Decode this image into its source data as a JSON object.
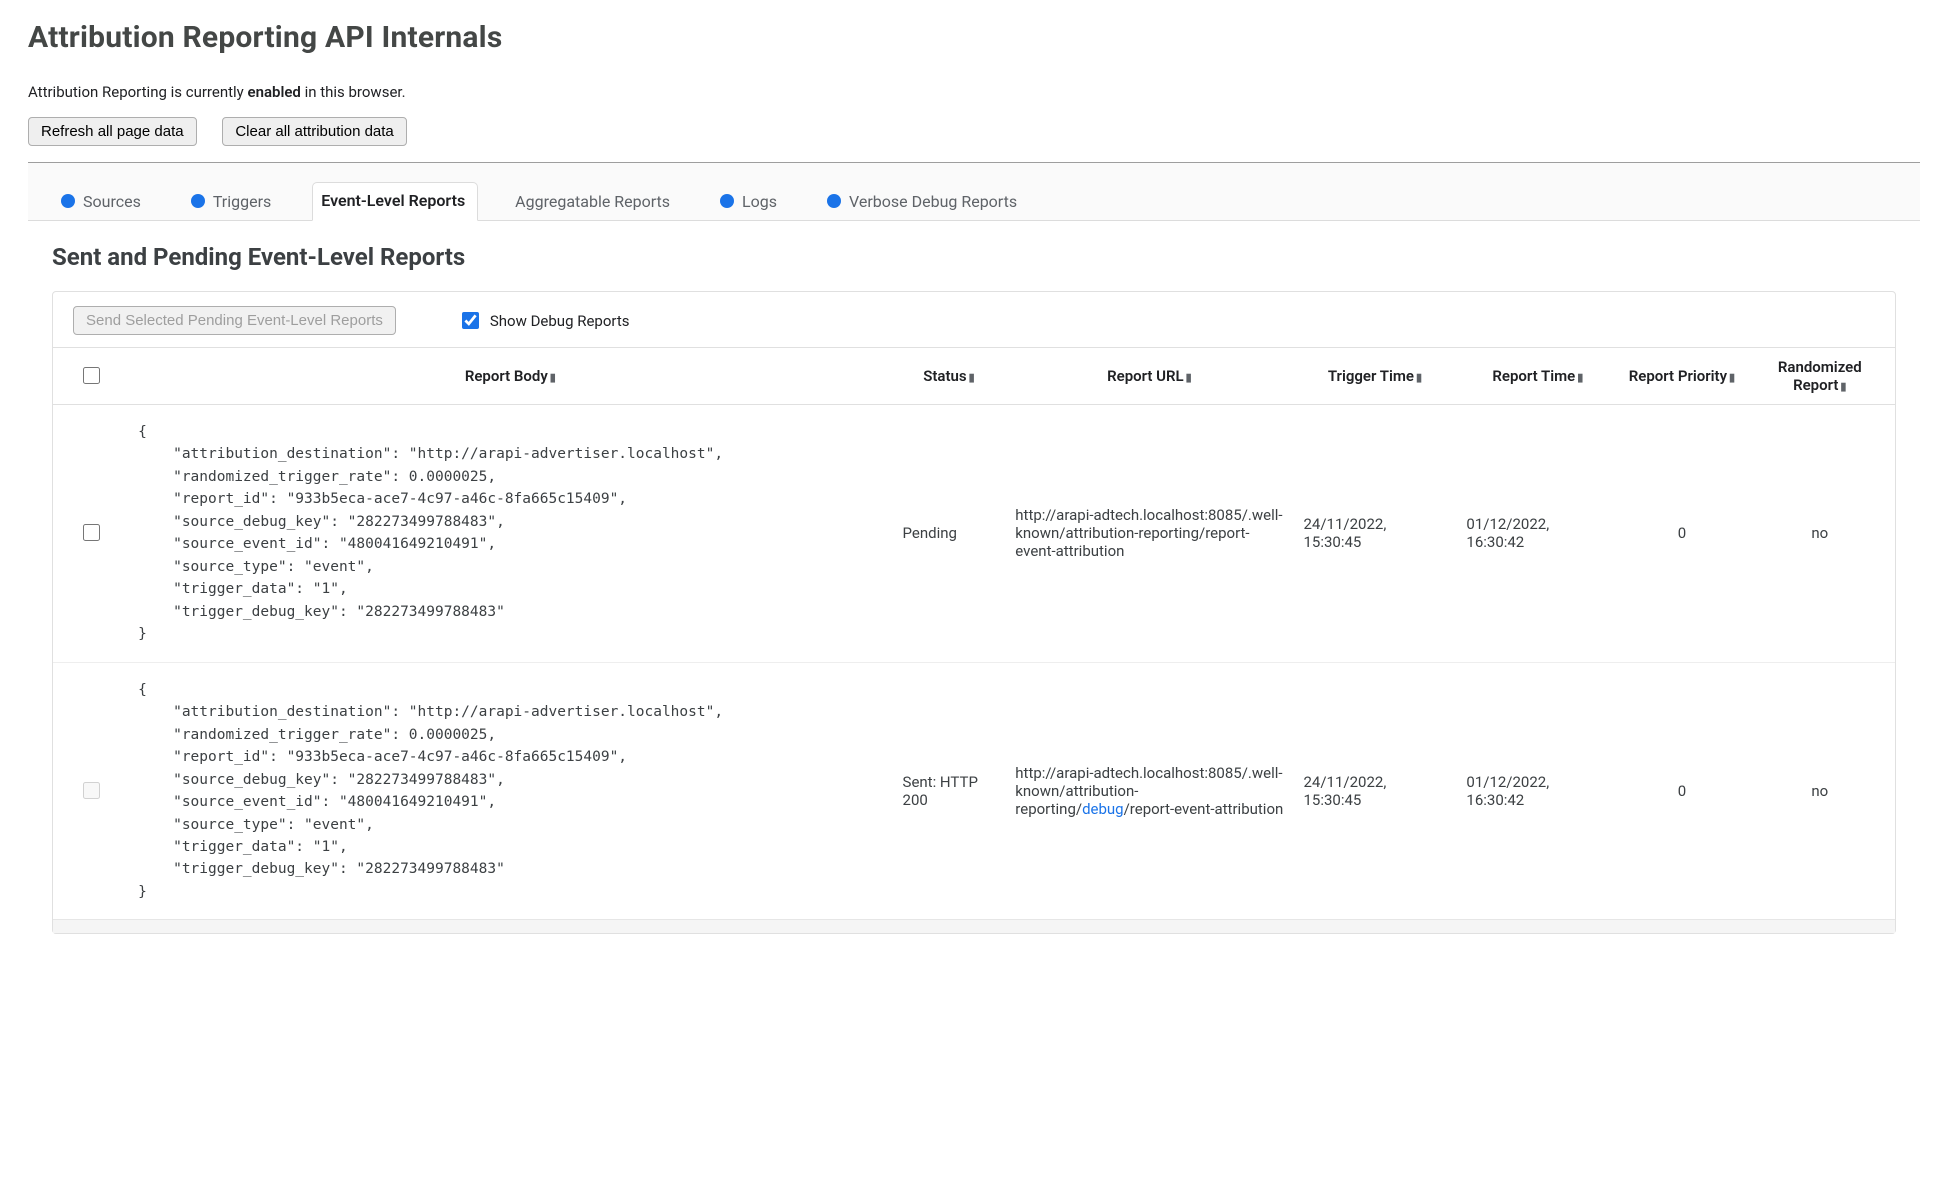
{
  "header": {
    "title": "Attribution Reporting API Internals",
    "status_prefix": "Attribution Reporting is currently ",
    "status_word": "enabled",
    "status_suffix": " in this browser.",
    "refresh_btn": "Refresh all page data",
    "clear_btn": "Clear all attribution data"
  },
  "tabs": [
    {
      "label": "Sources",
      "dot": true
    },
    {
      "label": "Triggers",
      "dot": true
    },
    {
      "label": "Event-Level Reports",
      "dot": false,
      "active": true
    },
    {
      "label": "Aggregatable Reports",
      "dot": false
    },
    {
      "label": "Logs",
      "dot": true
    },
    {
      "label": "Verbose Debug Reports",
      "dot": true
    }
  ],
  "section": {
    "heading": "Sent and Pending Event-Level Reports",
    "send_btn": "Send Selected Pending Event-Level Reports",
    "show_debug_label": "Show Debug Reports",
    "show_debug_checked": true
  },
  "columns": {
    "body": "Report Body",
    "status": "Status",
    "url": "Report URL",
    "tt": "Trigger Time",
    "rt": "Report Time",
    "pri": "Report Priority",
    "rand": "Randomized Report"
  },
  "rows": [
    {
      "body": "{\n    \"attribution_destination\": \"http://arapi-advertiser.localhost\",\n    \"randomized_trigger_rate\": 0.0000025,\n    \"report_id\": \"933b5eca-ace7-4c97-a46c-8fa665c15409\",\n    \"source_debug_key\": \"282273499788483\",\n    \"source_event_id\": \"480041649210491\",\n    \"source_type\": \"event\",\n    \"trigger_data\": \"1\",\n    \"trigger_debug_key\": \"282273499788483\"\n}",
      "status": "Pending",
      "url_pre": "http://arapi-adtech.localhost:8085/.well-known/attribution-reporting/report-event-attribution",
      "url_debug": "",
      "url_post": "",
      "trigger_time": "24/11/2022, 15:30:45",
      "report_time": "01/12/2022, 16:30:42",
      "priority": "0",
      "randomized": "no",
      "chk_enabled": true
    },
    {
      "body": "{\n    \"attribution_destination\": \"http://arapi-advertiser.localhost\",\n    \"randomized_trigger_rate\": 0.0000025,\n    \"report_id\": \"933b5eca-ace7-4c97-a46c-8fa665c15409\",\n    \"source_debug_key\": \"282273499788483\",\n    \"source_event_id\": \"480041649210491\",\n    \"source_type\": \"event\",\n    \"trigger_data\": \"1\",\n    \"trigger_debug_key\": \"282273499788483\"\n}",
      "status": "Sent: HTTP 200",
      "url_pre": "http://arapi-adtech.localhost:8085/.well-known/attribution-reporting/",
      "url_debug": "debug",
      "url_post": "/report-event-attribution",
      "trigger_time": "24/11/2022, 15:30:45",
      "report_time": "01/12/2022, 16:30:42",
      "priority": "0",
      "randomized": "no",
      "chk_enabled": false
    }
  ]
}
